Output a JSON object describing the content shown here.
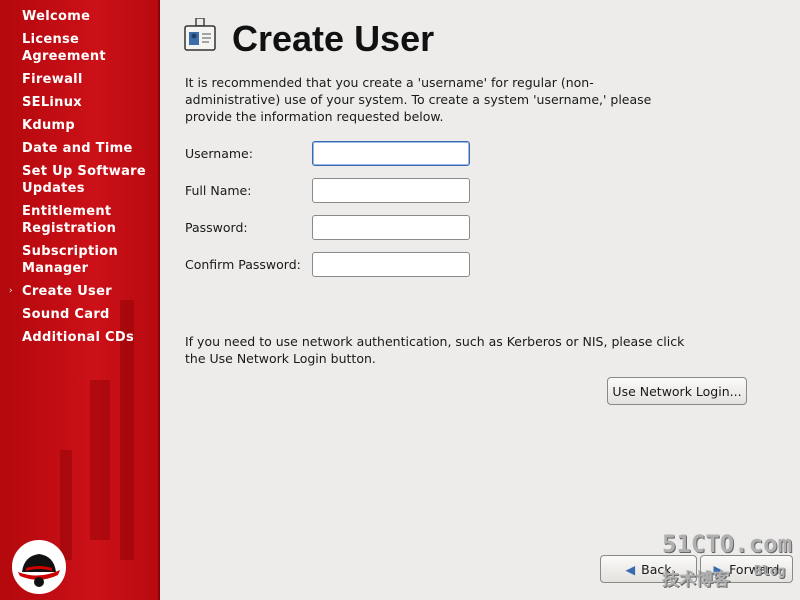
{
  "sidebar": {
    "items": [
      {
        "label": "Welcome"
      },
      {
        "label": "License Agreement"
      },
      {
        "label": "Firewall"
      },
      {
        "label": "SELinux"
      },
      {
        "label": "Kdump"
      },
      {
        "label": "Date and Time"
      },
      {
        "label": "Set Up Software Updates"
      },
      {
        "label": "Entitlement Registration"
      },
      {
        "label": "Subscription Manager"
      },
      {
        "label": "Create User",
        "current": true
      },
      {
        "label": "Sound Card"
      },
      {
        "label": "Additional CDs"
      }
    ],
    "current_marker": "›"
  },
  "main": {
    "title": "Create User",
    "title_icon": "id-badge-icon",
    "intro": "It is recommended that you create a 'username' for regular (non-administrative) use of your system. To create a system 'username,' please provide the information requested below.",
    "fields": [
      {
        "label": "Username:",
        "value": ""
      },
      {
        "label": "Full Name:",
        "value": ""
      },
      {
        "label": "Password:",
        "value": ""
      },
      {
        "label": "Confirm Password:",
        "value": ""
      }
    ],
    "network_text": "If you need to use network authentication, such as Kerberos or NIS, please click the Use Network Login button.",
    "network_button": "Use Network Login..."
  },
  "footer": {
    "back": "Back",
    "forward": "Forward"
  },
  "watermark": {
    "line1": "51CTO.com",
    "line2": "技术博客",
    "line3": "Blog"
  },
  "colors": {
    "sidebar": "#c4101a",
    "background": "#edeceb",
    "focus": "#3a6ab0"
  }
}
